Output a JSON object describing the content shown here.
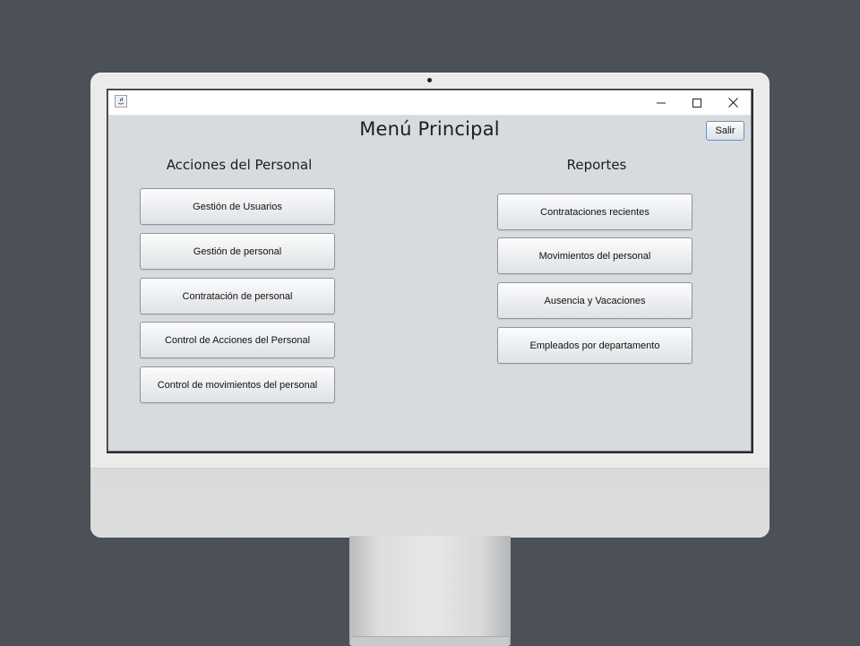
{
  "window": {
    "title": "",
    "controls": {
      "minimize": "minimize-icon",
      "maximize": "maximize-icon",
      "close": "close-icon"
    }
  },
  "main": {
    "title": "Menú Principal",
    "exit_label": "Salir"
  },
  "personnel": {
    "heading": "Acciones del Personal",
    "buttons": [
      {
        "label": "Gestión de Usuarios"
      },
      {
        "label": "Gestión de personal"
      },
      {
        "label": "Contratación de personal"
      },
      {
        "label": "Control de Acciones del Personal"
      },
      {
        "label": "Control de movimientos del personal"
      }
    ]
  },
  "reports": {
    "heading": "Reportes",
    "buttons": [
      {
        "label": "Contrataciones recientes"
      },
      {
        "label": "Movimientos del personal"
      },
      {
        "label": "Ausencia y Vacaciones"
      },
      {
        "label": "Empleados por departamento"
      }
    ]
  },
  "colors": {
    "desktop_background": "#4b5157",
    "window_background": "#d7dbe0",
    "titlebar": "#ffffff"
  }
}
